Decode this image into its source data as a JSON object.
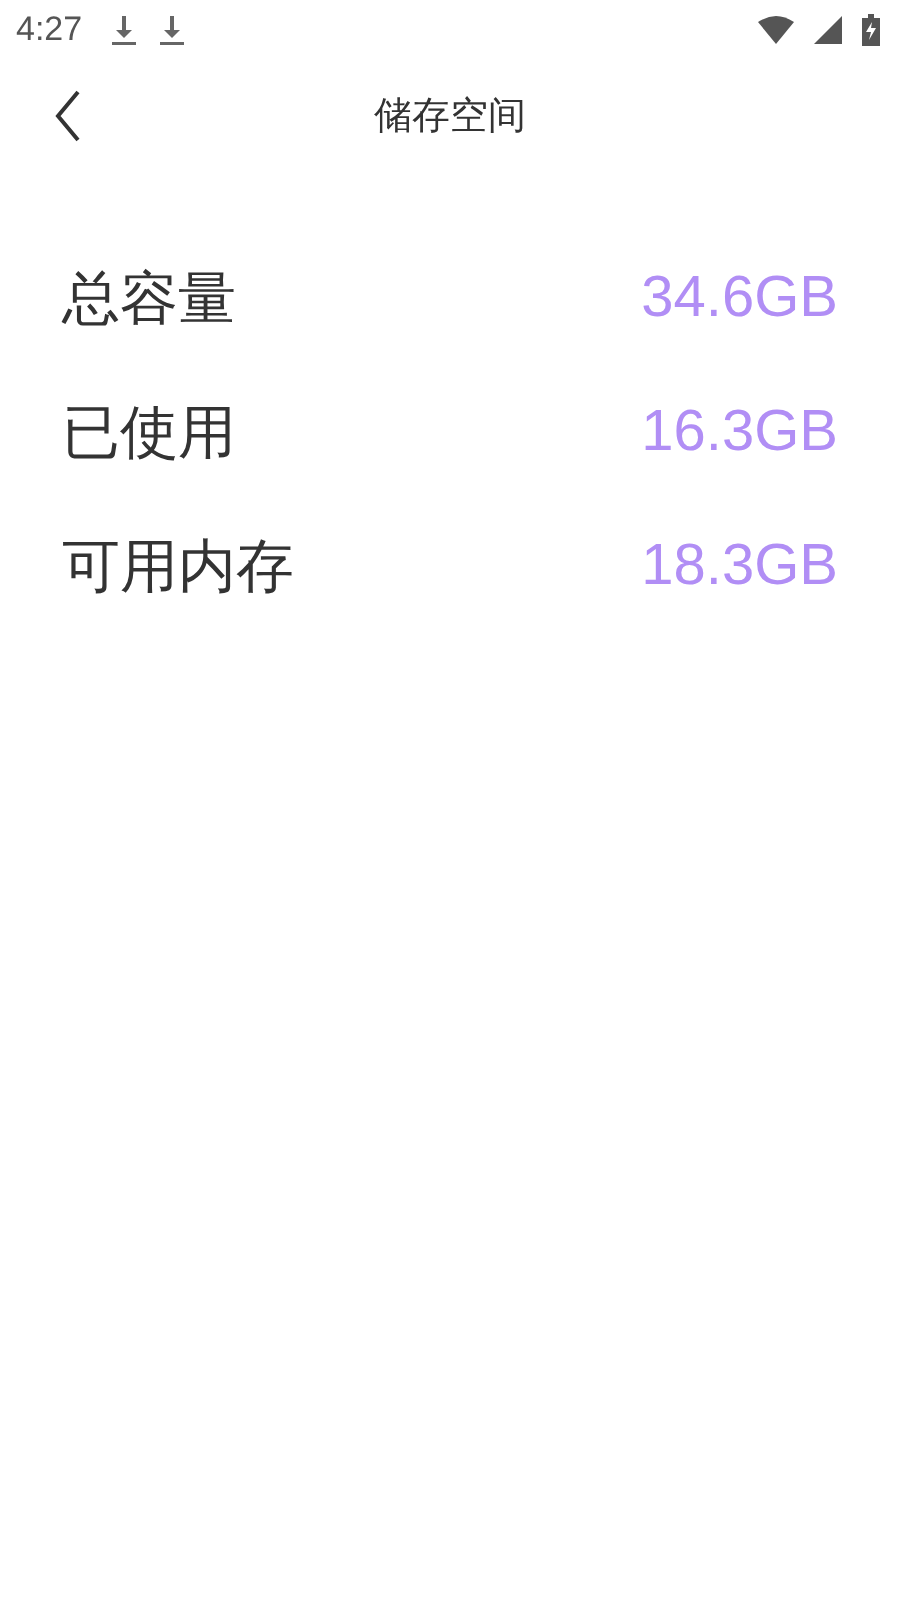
{
  "status_bar": {
    "time": "4:27"
  },
  "header": {
    "title": "储存空间"
  },
  "rows": [
    {
      "label": "总容量",
      "value": "34.6GB"
    },
    {
      "label": "已使用",
      "value": "16.3GB"
    },
    {
      "label": "可用内存",
      "value": "18.3GB"
    }
  ]
}
